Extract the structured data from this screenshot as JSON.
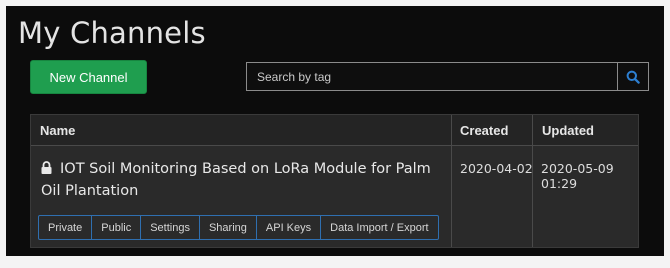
{
  "page": {
    "title": "My Channels"
  },
  "toolbar": {
    "new_channel_label": "New Channel",
    "search_placeholder": "Search by tag"
  },
  "table": {
    "headers": {
      "name": "Name",
      "created": "Created",
      "updated": "Updated"
    },
    "rows": [
      {
        "name": "IOT Soil Monitoring Based on LoRa Module for Palm Oil Plantation",
        "created": "2020-04-02",
        "updated": "2020-05-09 01:29",
        "actions": [
          "Private",
          "Public",
          "Settings",
          "Sharing",
          "API Keys",
          "Data Import / Export"
        ]
      }
    ]
  },
  "icons": {
    "search": "search-icon",
    "lock": "lock-icon"
  },
  "colors": {
    "accent_green": "#1f9e4f",
    "button_border_blue": "#2f6fb0",
    "search_icon_blue": "#2d7fd1"
  }
}
